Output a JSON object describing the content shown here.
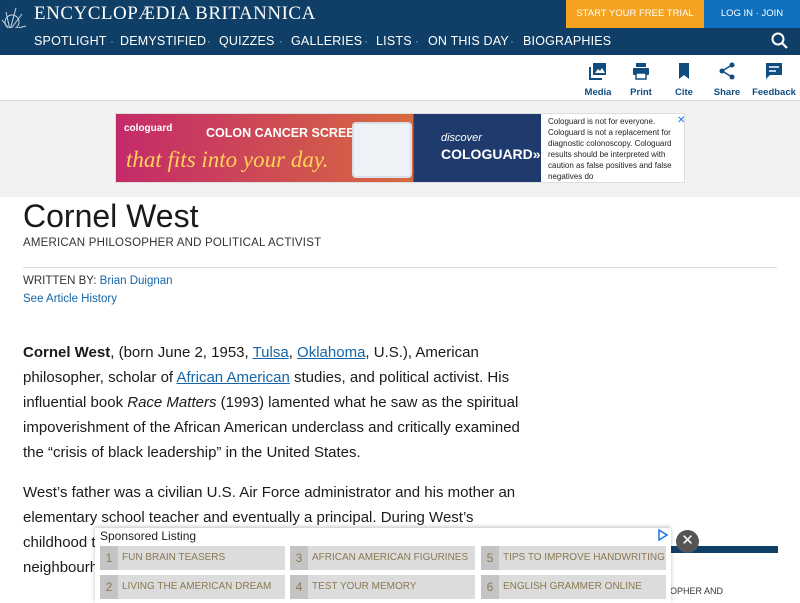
{
  "header": {
    "brand": "ENCYCLOPÆDIA BRITANNICA",
    "trial_label": "START YOUR FREE TRIAL",
    "login_label": "LOG IN · JOIN"
  },
  "nav": {
    "items": [
      "SPOTLIGHT",
      "DEMYSTIFIED",
      "QUIZZES",
      "GALLERIES",
      "LISTS",
      "ON THIS DAY",
      "BIOGRAPHIES"
    ]
  },
  "toolbar": {
    "items": [
      "Media",
      "Print",
      "Cite",
      "Share",
      "Feedback"
    ]
  },
  "ad": {
    "brand": "cologuard",
    "headline": "COLON CANCER SCREENING",
    "script": "that fits into your day.",
    "discover": "discover",
    "cta": "COLOGUARD»",
    "fine_print": "Cologuard is not for everyone. Cologuard is not a replacement for diagnostic colonoscopy. Cologuard results should be interpreted with caution as false positives and false negatives do",
    "close": "✕"
  },
  "article": {
    "title": "Cornel West",
    "subtitle": "AMERICAN PHILOSOPHER AND POLITICAL ACTIVIST",
    "written_by_label": "WRITTEN BY: ",
    "author": "Brian Duignan",
    "history_link": "See Article History",
    "p1": {
      "name": "Cornel West",
      "t1": ", (born June 2, 1953, ",
      "link1": "Tulsa",
      "t2": ", ",
      "link2": "Oklahoma",
      "t3": ", U.S.), American philosopher, scholar of ",
      "link3": "African American",
      "t4": " studies, and political activist. His influential book ",
      "book": "Race Matters",
      "t5": " (1993) lamented what he saw as the spiritual impoverishment of the African American underclass and critically examined the “crisis of black leadership” in the United States."
    },
    "p2": "West’s father was a civilian U.S. Air Force administrator and his mother an elementary school teacher and eventually a principal. During West’s childhood the family moved to Sacramento, California, where in the neighbourhood he was exposed to the Black Panthers. West attended s"
  },
  "right_box": {
    "text": "OPHER AND"
  },
  "sponsored": {
    "title": "Sponsored Listing",
    "items": [
      {
        "num": "1",
        "label": "FUN BRAIN TEASERS"
      },
      {
        "num": "3",
        "label": "AFRICAN AMERICAN FIGURINES"
      },
      {
        "num": "5",
        "label": "TIPS TO IMPROVE HANDWRITING"
      },
      {
        "num": "2",
        "label": "LIVING THE AMERICAN DREAM"
      },
      {
        "num": "4",
        "label": "TEST YOUR MEMORY"
      },
      {
        "num": "6",
        "label": "ENGLISH GRAMMER ONLINE"
      }
    ],
    "close": "✕"
  }
}
